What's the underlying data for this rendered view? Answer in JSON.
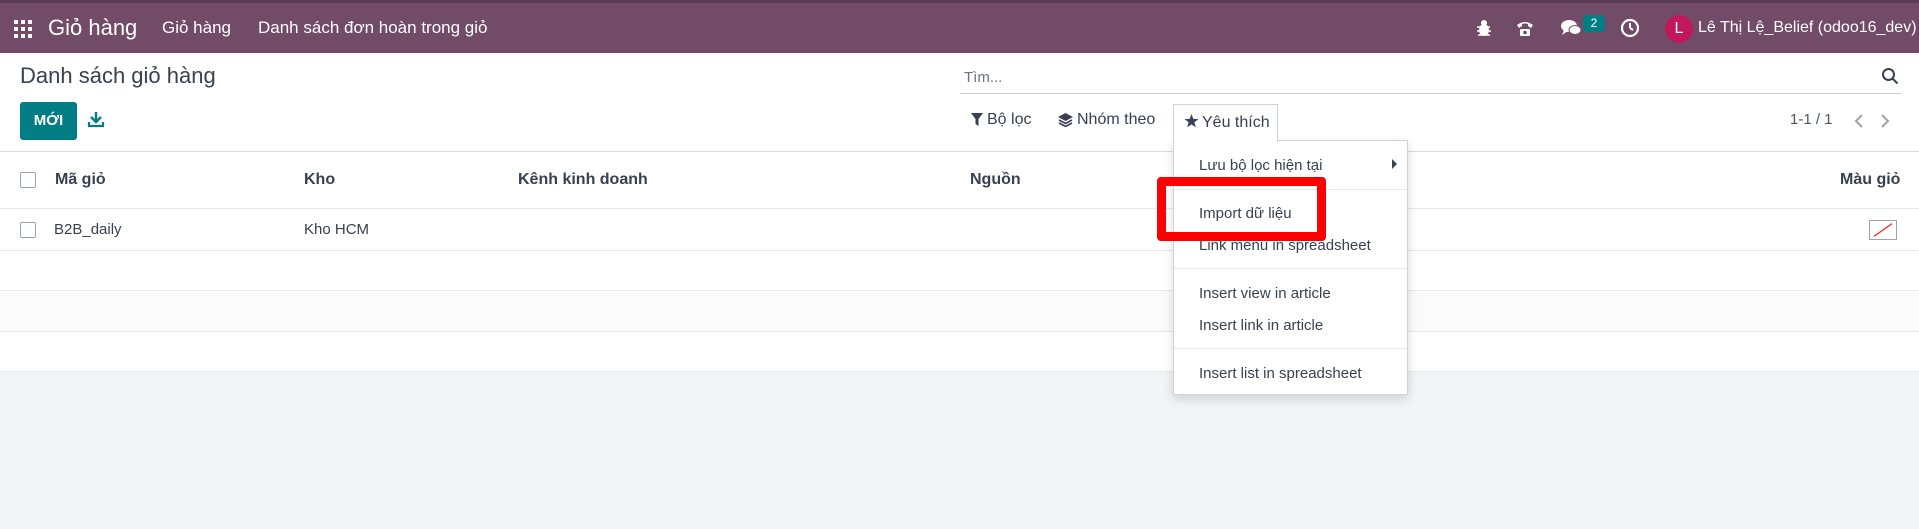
{
  "navbar": {
    "brand": "Giỏ hàng",
    "menu": [
      "Giỏ hàng",
      "Danh sách đơn hoàn trong giỏ"
    ],
    "icons": [
      "bug-icon",
      "phone-icon",
      "chat-icon",
      "clock-icon"
    ],
    "chat_badge": "2",
    "user_initial": "L",
    "user_name": "Lê Thị Lệ_Belief (odoo16_dev)",
    "colors": {
      "navbar": "#714b67",
      "primary": "#017e84"
    }
  },
  "control": {
    "title": "Danh sách giỏ hàng",
    "new_button": "MỚI",
    "search_placeholder": "Tìm...",
    "filter_label": "Bộ lọc",
    "group_label": "Nhóm theo",
    "favorite_label": "Yêu thích",
    "pager": "1-1 / 1"
  },
  "table": {
    "columns": [
      "Mã giỏ",
      "Kho",
      "Kênh kinh doanh",
      "Nguồn",
      "Màu giỏ"
    ],
    "rows": [
      {
        "code": "B2B_daily",
        "warehouse": "Kho HCM",
        "channel": "",
        "source": ""
      }
    ]
  },
  "favorites_menu": {
    "save_filter": "Lưu bộ lọc hiện tại",
    "items": [
      "Import dữ liệu",
      "Link menu in spreadsheet",
      "Insert view in article",
      "Insert link in article",
      "Insert list in spreadsheet"
    ]
  }
}
